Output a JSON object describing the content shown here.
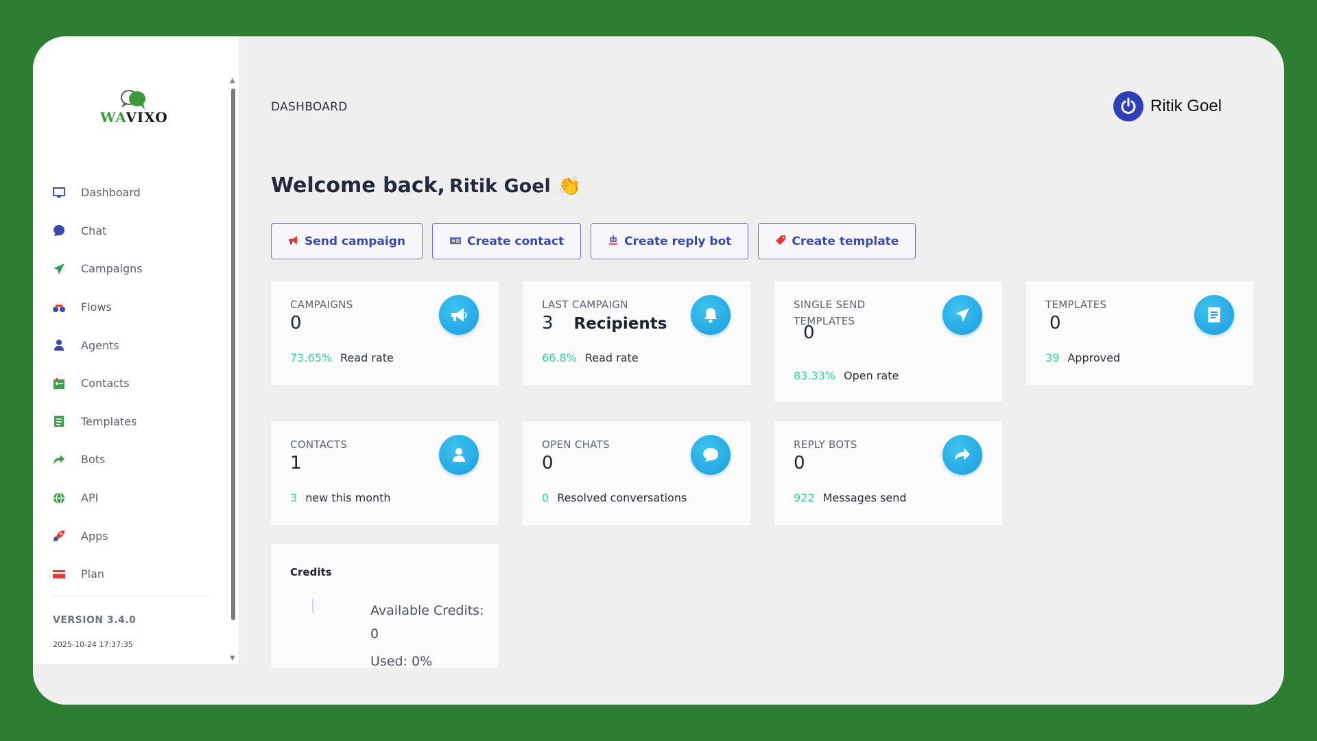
{
  "brand": {
    "logo_wa": "WA",
    "logo_vixo": "VIXO"
  },
  "sidebar": {
    "items": [
      {
        "label": "Dashboard",
        "icon": "monitor-icon"
      },
      {
        "label": "Chat",
        "icon": "chat-bubble-icon"
      },
      {
        "label": "Campaigns",
        "icon": "paper-plane-icon"
      },
      {
        "label": "Flows",
        "icon": "flow-icon"
      },
      {
        "label": "Agents",
        "icon": "user-icon"
      },
      {
        "label": "Contacts",
        "icon": "contact-card-icon"
      },
      {
        "label": "Templates",
        "icon": "document-icon"
      },
      {
        "label": "Bots",
        "icon": "share-arrow-icon"
      },
      {
        "label": "API",
        "icon": "globe-icon"
      },
      {
        "label": "Apps",
        "icon": "rocket-icon"
      },
      {
        "label": "Plan",
        "icon": "credit-card-icon"
      }
    ],
    "version": "VERSION 3.4.0",
    "build_date": "2025-10-24 17:37:35"
  },
  "header": {
    "page_title": "DASHBOARD",
    "user_name": "Ritik Goel"
  },
  "welcome": {
    "greeting": "Welcome back,",
    "user_name": "Ritik Goel",
    "emoji": "👏"
  },
  "actions": [
    {
      "label": "Send campaign",
      "icon": "megaphone-icon"
    },
    {
      "label": "Create contact",
      "icon": "id-card-icon"
    },
    {
      "label": "Create reply bot",
      "icon": "robot-icon"
    },
    {
      "label": "Create template",
      "icon": "tag-icon"
    }
  ],
  "stats": {
    "campaigns": {
      "title": "CAMPAIGNS",
      "value": "0",
      "sub_value": "73.65%",
      "sub_label": "Read rate",
      "icon": "megaphone-icon"
    },
    "last_campaign": {
      "title": "LAST CAMPAIGN",
      "value": "3",
      "value_suffix": "Recipients",
      "sub_value": "66.8%",
      "sub_label": "Read rate",
      "icon": "bell-icon"
    },
    "single_send": {
      "title": "SINGLE SEND TEMPLATES",
      "value": "0",
      "sub_value": "83.33%",
      "sub_label": "Open rate",
      "icon": "paper-plane-icon"
    },
    "templates": {
      "title": "TEMPLATES",
      "value": "0",
      "sub_value": "39",
      "sub_label": "Approved",
      "icon": "document-icon"
    },
    "contacts": {
      "title": "CONTACTS",
      "value": "1",
      "sub_value": "3",
      "sub_label": "new this month",
      "icon": "user-icon"
    },
    "open_chats": {
      "title": "OPEN CHATS",
      "value": "0",
      "sub_value": "0",
      "sub_label": "Resolved conversations",
      "icon": "chat-bubble-icon"
    },
    "reply_bots": {
      "title": "REPLY BOTS",
      "value": "0",
      "sub_value": "922",
      "sub_label": "Messages send",
      "icon": "share-arrow-icon"
    }
  },
  "credits": {
    "title": "Credits",
    "available_label": "Available Credits:",
    "available_value": "0",
    "used": "Used: 0%"
  },
  "colors": {
    "background": "#2d7d32",
    "accent": "#3949ab",
    "positive": "#3ccf9a",
    "icon_circle": "#1b9be0"
  }
}
